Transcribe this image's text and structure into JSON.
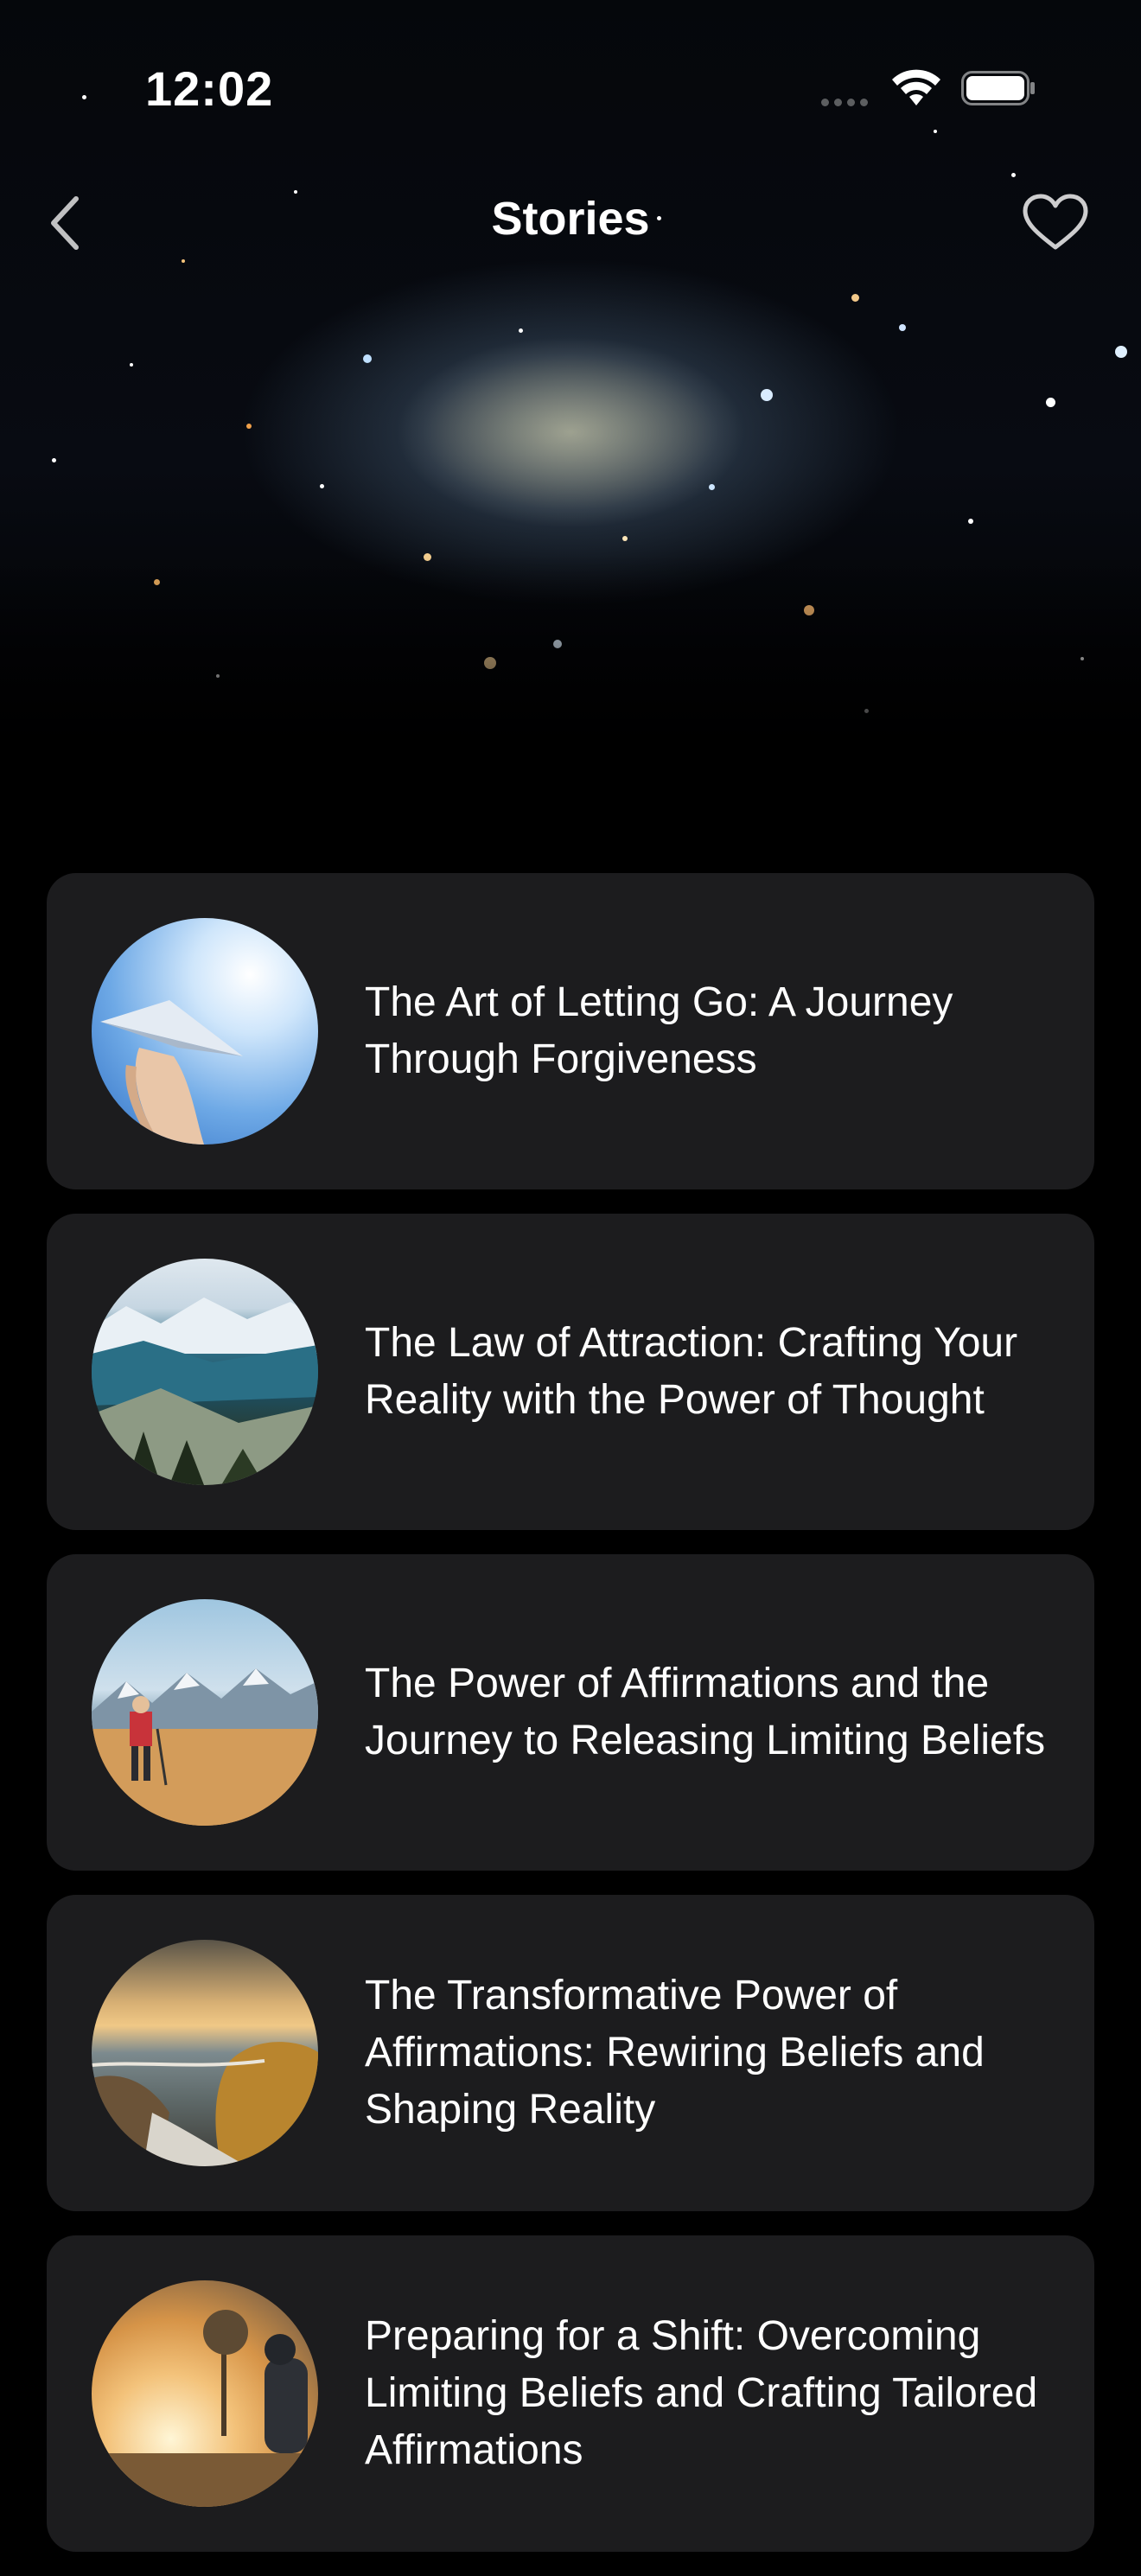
{
  "status_bar": {
    "time": "12:02",
    "wifi_icon": "wifi-icon",
    "battery_icon": "battery-icon"
  },
  "nav": {
    "back_icon": "chevron-left-icon",
    "title": "Stories",
    "favorite_icon": "heart-icon"
  },
  "hero": {
    "image": "galaxy-image"
  },
  "stories": [
    {
      "title": "The Art of Letting Go: A Journey Through Forgiveness",
      "thumbnail": "paper-plane-sky-image"
    },
    {
      "title": "The Law of Attraction: Crafting Your Reality with the Power of Thought",
      "thumbnail": "mountain-valley-image"
    },
    {
      "title": "The Power of Affirmations and the Journey to Releasing Limiting Beliefs",
      "thumbnail": "hiker-mountains-image"
    },
    {
      "title": "The Transformative Power of Affirmations: Rewiring Beliefs and Shaping Reality",
      "thumbnail": "coastal-waterfall-image"
    },
    {
      "title": "Preparing for a Shift: Overcoming Limiting Beliefs and Crafting Tailored Affirmations",
      "thumbnail": "sunset-traveler-image"
    }
  ],
  "colors": {
    "background": "#000000",
    "card": "#1c1c1e",
    "text": "#ffffff"
  }
}
